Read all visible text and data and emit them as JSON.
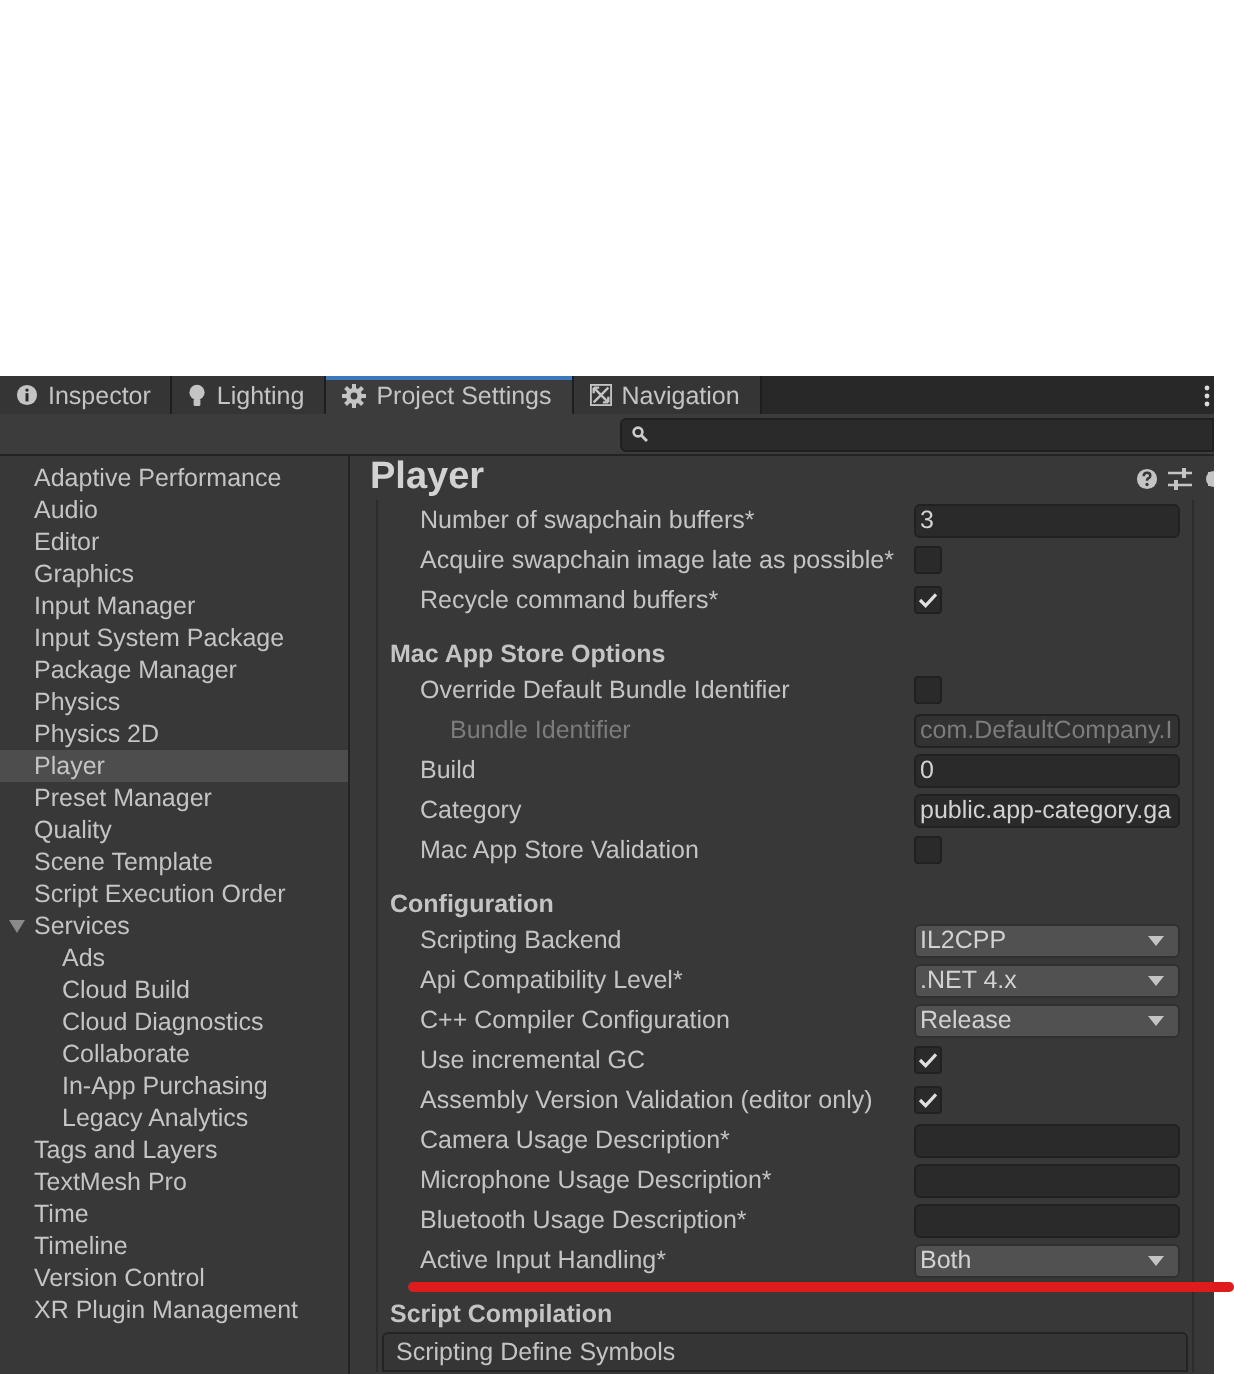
{
  "tabs": [
    {
      "label": "Inspector",
      "selected": false
    },
    {
      "label": "Lighting",
      "selected": false
    },
    {
      "label": "Project Settings",
      "selected": true
    },
    {
      "label": "Navigation",
      "selected": false
    }
  ],
  "sidebar": {
    "items": [
      {
        "label": "Adaptive Performance",
        "selected": false
      },
      {
        "label": "Audio",
        "selected": false
      },
      {
        "label": "Editor",
        "selected": false
      },
      {
        "label": "Graphics",
        "selected": false
      },
      {
        "label": "Input Manager",
        "selected": false
      },
      {
        "label": "Input System Package",
        "selected": false
      },
      {
        "label": "Package Manager",
        "selected": false
      },
      {
        "label": "Physics",
        "selected": false
      },
      {
        "label": "Physics 2D",
        "selected": false
      },
      {
        "label": "Player",
        "selected": true
      },
      {
        "label": "Preset Manager",
        "selected": false
      },
      {
        "label": "Quality",
        "selected": false
      },
      {
        "label": "Scene Template",
        "selected": false
      },
      {
        "label": "Script Execution Order",
        "selected": false
      },
      {
        "label": "Services",
        "selected": false,
        "expanded": true,
        "children": [
          {
            "label": "Ads",
            "selected": false
          },
          {
            "label": "Cloud Build",
            "selected": false
          },
          {
            "label": "Cloud Diagnostics",
            "selected": false
          },
          {
            "label": "Collaborate",
            "selected": false
          },
          {
            "label": "In-App Purchasing",
            "selected": false
          },
          {
            "label": "Legacy Analytics",
            "selected": false
          }
        ]
      },
      {
        "label": "Tags and Layers",
        "selected": false
      },
      {
        "label": "TextMesh Pro",
        "selected": false
      },
      {
        "label": "Time",
        "selected": false
      },
      {
        "label": "Timeline",
        "selected": false
      },
      {
        "label": "Version Control",
        "selected": false
      },
      {
        "label": "XR Plugin Management",
        "selected": false
      }
    ]
  },
  "player": {
    "title": "Player",
    "sections": [
      {
        "rows": [
          {
            "kind": "text",
            "label": "Number of swapchain buffers*",
            "value": "3"
          },
          {
            "kind": "checkbox",
            "label": "Acquire swapchain image late as possible*",
            "checked": false
          },
          {
            "kind": "checkbox",
            "label": "Recycle command buffers*",
            "checked": true
          }
        ]
      },
      {
        "heading": "Mac App Store Options",
        "rows": [
          {
            "kind": "checkbox",
            "label": "Override Default Bundle Identifier",
            "checked": false,
            "children": [
              {
                "kind": "text",
                "label": "Bundle Identifier",
                "value": "com.DefaultCompany.I",
                "disabled": true
              }
            ]
          },
          {
            "kind": "text",
            "label": "Build",
            "value": "0"
          },
          {
            "kind": "text",
            "label": "Category",
            "value": "public.app-category.ga"
          },
          {
            "kind": "checkbox",
            "label": "Mac App Store Validation",
            "checked": false
          }
        ]
      },
      {
        "heading": "Configuration",
        "rows": [
          {
            "kind": "dropdown",
            "label": "Scripting Backend",
            "value": "IL2CPP"
          },
          {
            "kind": "dropdown",
            "label": "Api Compatibility Level*",
            "value": ".NET 4.x"
          },
          {
            "kind": "dropdown",
            "label": "C++ Compiler Configuration",
            "value": "Release"
          },
          {
            "kind": "checkbox",
            "label": "Use incremental GC",
            "checked": true
          },
          {
            "kind": "checkbox",
            "label": "Assembly Version Validation (editor only)",
            "checked": true
          },
          {
            "kind": "text",
            "label": "Camera Usage Description*"
          },
          {
            "kind": "text",
            "label": "Microphone Usage Description*"
          },
          {
            "kind": "text",
            "label": "Bluetooth Usage Description*"
          },
          {
            "kind": "dropdown",
            "label": "Active Input Handling*",
            "value": "Both"
          }
        ]
      },
      {
        "heading": "Script Compilation",
        "rows": [
          {
            "kind": "list",
            "label": "Scripting Define Symbols"
          }
        ]
      }
    ]
  }
}
